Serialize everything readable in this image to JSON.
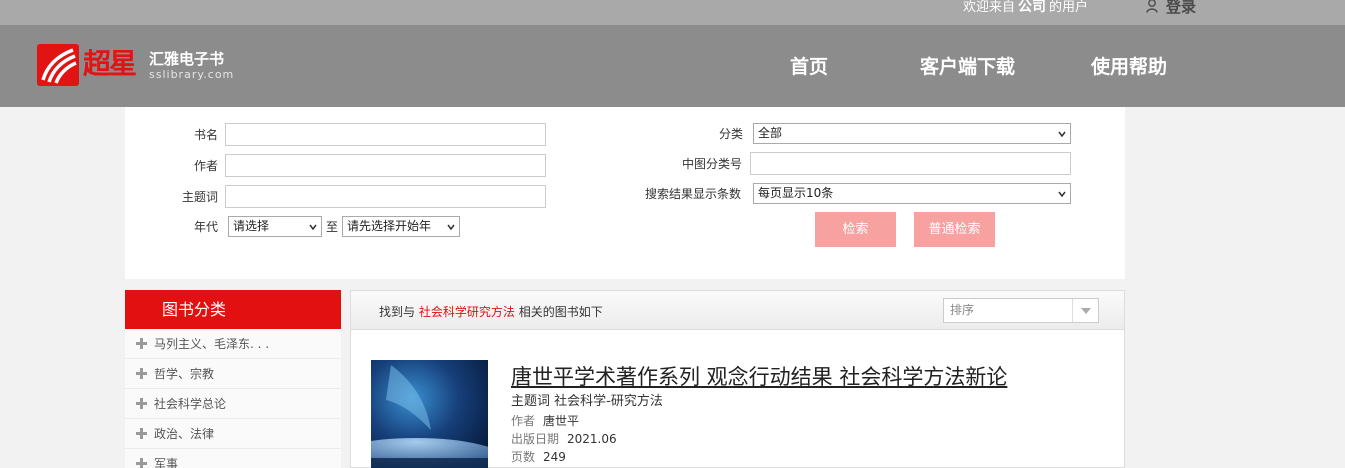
{
  "topbar": {
    "welcome_prefix": "欢迎来自",
    "org": "公司",
    "welcome_suffix": "的用户",
    "login": "登录"
  },
  "header": {
    "brand_logo_text": "超星",
    "brand_cn": "汇雅电子书",
    "brand_en": "sslibrary.com",
    "nav": [
      "首页",
      "客户端下载",
      "使用帮助"
    ]
  },
  "search": {
    "title_label": "书名",
    "title_value": "",
    "author_label": "作者",
    "author_value": "",
    "subject_label": "主题词",
    "subject_value": "",
    "year_label": "年代",
    "year_from": "请选择",
    "year_to_sep": "至",
    "year_to": "请先选择开始年",
    "category_label": "分类",
    "category_value": "全部",
    "clc_label": "中图分类号",
    "clc_value": "",
    "per_page_label": "搜索结果显示条数",
    "per_page_value": "每页显示10条",
    "search_btn": "检索",
    "basic_btn": "普通检索"
  },
  "sidebar": {
    "title": "图书分类",
    "items": [
      "马列主义、毛泽东. . .",
      "哲学、宗教",
      "社会科学总论",
      "政治、法律",
      "军事"
    ]
  },
  "results": {
    "found_prefix": "找到与",
    "keyword": "社会科学研究方法",
    "found_suffix": "相关的图书如下",
    "sort_placeholder": "排序",
    "book": {
      "title": "唐世平学术著作系列 观念行动结果 社会科学方法新论",
      "subject_label": "主题词",
      "subject": "社会科学-研究方法",
      "author_label": "作者",
      "author": "唐世平",
      "date_label": "出版日期",
      "date": "2021.06",
      "pages_label": "页数",
      "pages": "249"
    }
  },
  "colors": {
    "brand_red": "#e21313",
    "button_pink": "#f7a1a1",
    "header_gray": "#8c8c8c",
    "topbar_gray": "#a9a9a9"
  }
}
